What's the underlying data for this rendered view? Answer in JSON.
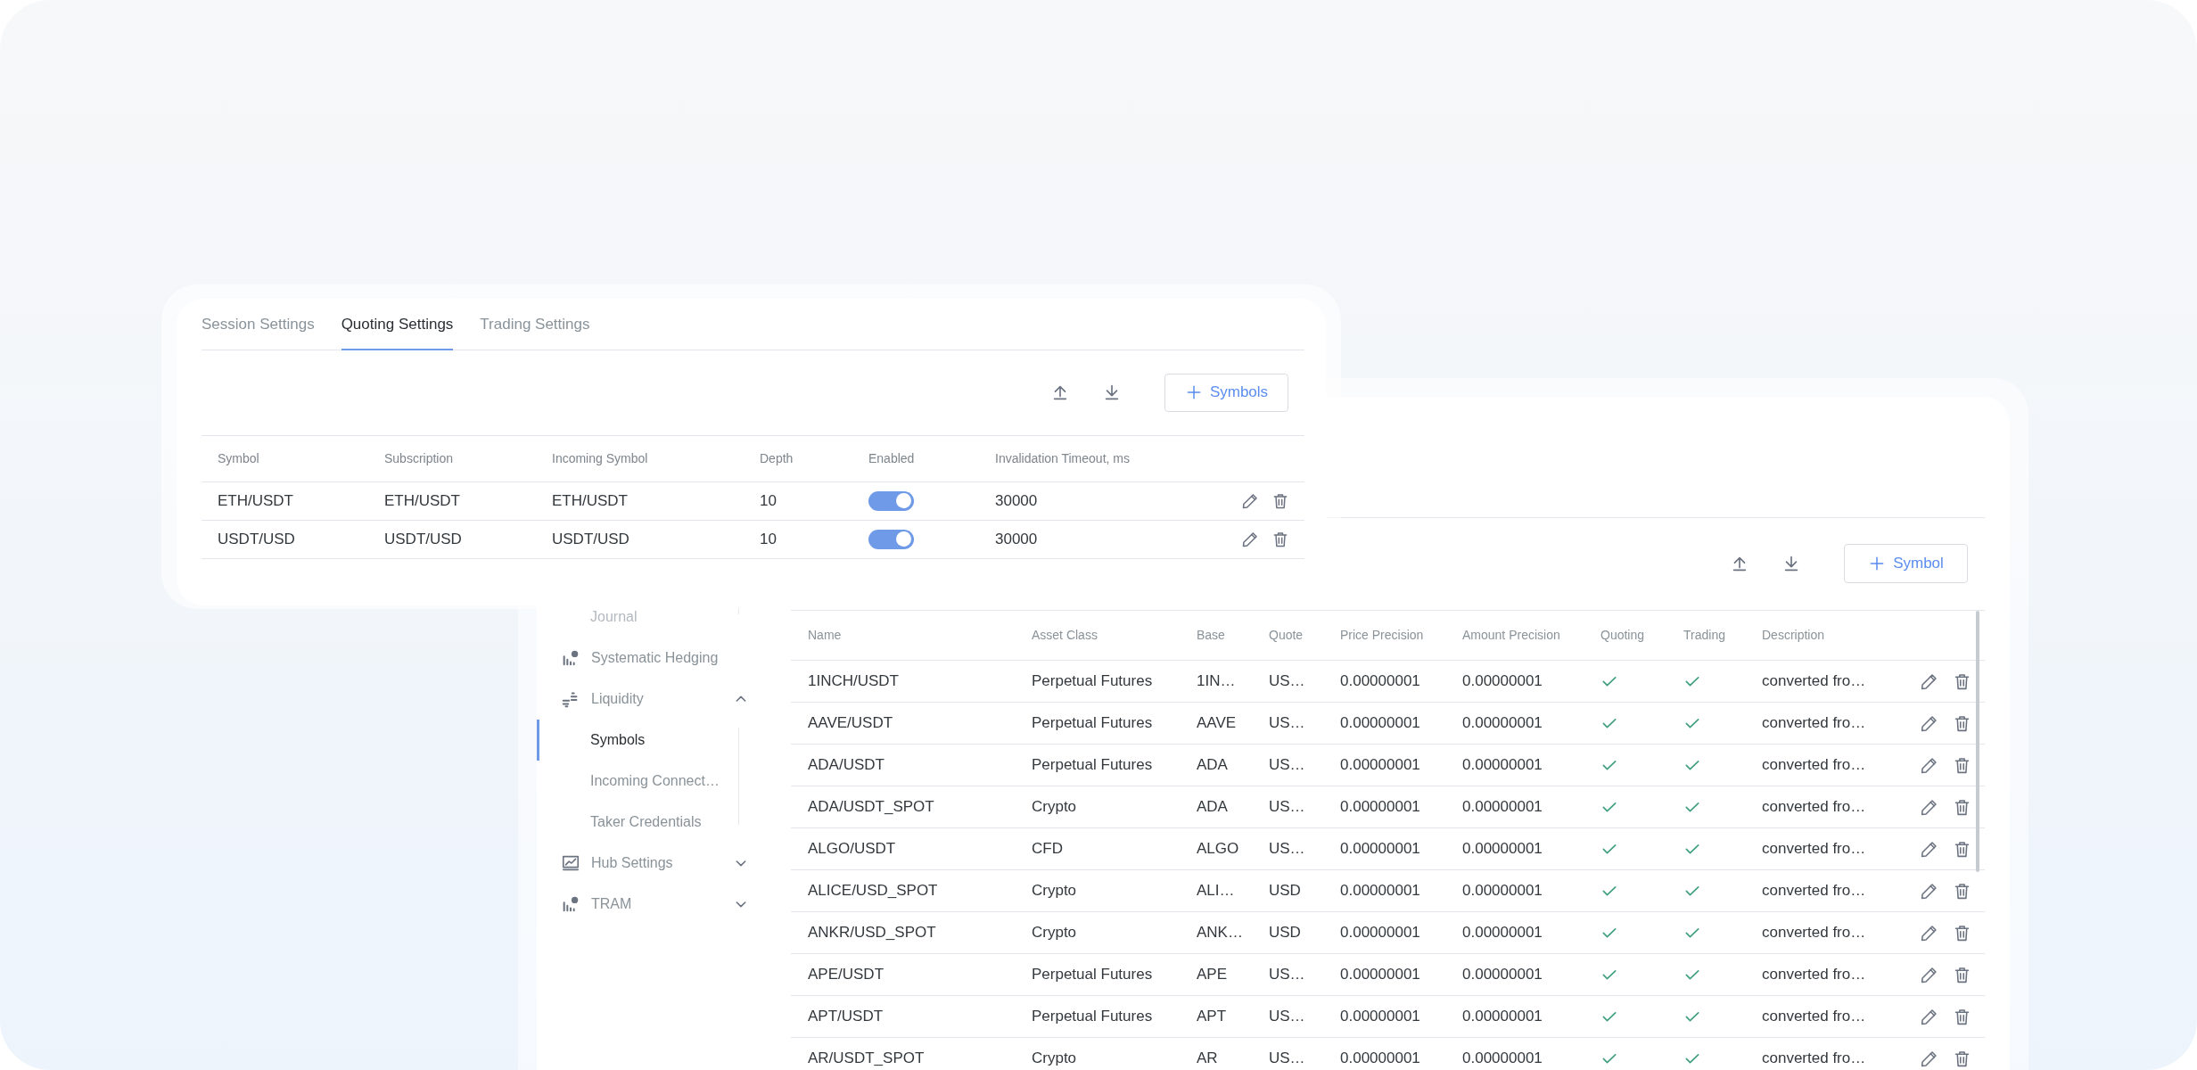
{
  "quoting_panel": {
    "tabs": [
      {
        "label": "Session Settings",
        "selected": false
      },
      {
        "label": "Quoting Settings",
        "selected": true
      },
      {
        "label": "Trading Settings",
        "selected": false
      }
    ],
    "add_button": "Symbols",
    "table": {
      "columns": [
        "Symbol",
        "Subscription",
        "Incoming Symbol",
        "Depth",
        "Enabled",
        "Invalidation Timeout, ms"
      ],
      "rows": [
        {
          "symbol": "ETH/USDT",
          "subscription": "ETH/USDT",
          "incoming_symbol": "ETH/USDT",
          "depth": "10",
          "enabled": true,
          "invalidation_timeout": "30000"
        },
        {
          "symbol": "USDT/USD",
          "subscription": "USDT/USD",
          "incoming_symbol": "USDT/USD",
          "depth": "10",
          "enabled": true,
          "invalidation_timeout": "30000"
        }
      ]
    }
  },
  "symbols_panel": {
    "sidebar": {
      "continued_children": [
        {
          "label": "Journal",
          "selected": false
        }
      ],
      "items": [
        {
          "label": "Systematic Hedging",
          "kind": "link",
          "selected": false
        },
        {
          "label": "Liquidity",
          "kind": "group",
          "selected": false,
          "expanded": true,
          "children": [
            {
              "label": "Symbols",
              "selected": true
            },
            {
              "label": "Incoming Connect…",
              "selected": false
            },
            {
              "label": "Taker Credentials",
              "selected": false
            }
          ]
        },
        {
          "label": "Hub Settings",
          "kind": "group",
          "selected": false,
          "expanded": false
        },
        {
          "label": "TRAM",
          "kind": "group",
          "selected": false,
          "expanded": false
        }
      ]
    },
    "add_button": "Symbol",
    "table": {
      "columns": [
        "Name",
        "Asset Class",
        "Base",
        "Quote",
        "Price Precision",
        "Amount Precision",
        "Quoting",
        "Trading",
        "Description"
      ],
      "rows": [
        {
          "name": "1INCH/USDT",
          "asset_class": "Perpetual Futures",
          "base": "1IN…",
          "quote": "US…",
          "price_precision": "0.00000001",
          "amount_precision": "0.00000001",
          "quoting": true,
          "trading": true,
          "description": "converted fro…"
        },
        {
          "name": "AAVE/USDT",
          "asset_class": "Perpetual Futures",
          "base": "AAVE",
          "quote": "US…",
          "price_precision": "0.00000001",
          "amount_precision": "0.00000001",
          "quoting": true,
          "trading": true,
          "description": "converted fro…"
        },
        {
          "name": "ADA/USDT",
          "asset_class": "Perpetual Futures",
          "base": "ADA",
          "quote": "US…",
          "price_precision": "0.00000001",
          "amount_precision": "0.00000001",
          "quoting": true,
          "trading": true,
          "description": "converted fro…"
        },
        {
          "name": "ADA/USDT_SPOT",
          "asset_class": "Crypto",
          "base": "ADA",
          "quote": "US…",
          "price_precision": "0.00000001",
          "amount_precision": "0.00000001",
          "quoting": true,
          "trading": true,
          "description": "converted fro…"
        },
        {
          "name": "ALGO/USDT",
          "asset_class": "CFD",
          "base": "ALGO",
          "quote": "US…",
          "price_precision": "0.00000001",
          "amount_precision": "0.00000001",
          "quoting": true,
          "trading": true,
          "description": "converted fro…"
        },
        {
          "name": "ALICE/USD_SPOT",
          "asset_class": "Crypto",
          "base": "ALI…",
          "quote": "USD",
          "price_precision": "0.00000001",
          "amount_precision": "0.00000001",
          "quoting": true,
          "trading": true,
          "description": "converted fro…"
        },
        {
          "name": "ANKR/USD_SPOT",
          "asset_class": "Crypto",
          "base": "ANK…",
          "quote": "USD",
          "price_precision": "0.00000001",
          "amount_precision": "0.00000001",
          "quoting": true,
          "trading": true,
          "description": "converted fro…"
        },
        {
          "name": "APE/USDT",
          "asset_class": "Perpetual Futures",
          "base": "APE",
          "quote": "US…",
          "price_precision": "0.00000001",
          "amount_precision": "0.00000001",
          "quoting": true,
          "trading": true,
          "description": "converted fro…"
        },
        {
          "name": "APT/USDT",
          "asset_class": "Perpetual Futures",
          "base": "APT",
          "quote": "US…",
          "price_precision": "0.00000001",
          "amount_precision": "0.00000001",
          "quoting": true,
          "trading": true,
          "description": "converted fro…"
        },
        {
          "name": "AR/USDT_SPOT",
          "asset_class": "Crypto",
          "base": "AR",
          "quote": "US…",
          "price_precision": "0.00000001",
          "amount_precision": "0.00000001",
          "quoting": true,
          "trading": true,
          "description": "converted fro…"
        }
      ]
    }
  }
}
